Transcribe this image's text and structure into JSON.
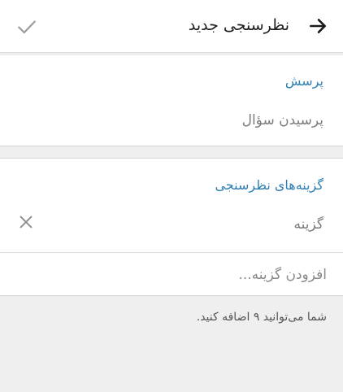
{
  "header": {
    "title": "نظرسنجی جدید",
    "back_icon": "arrow-right-icon",
    "confirm_icon": "check-icon"
  },
  "question": {
    "section_title": "پرسش",
    "placeholder": "پرسیدن سؤال"
  },
  "options": {
    "section_title": "گزینه‌های نظرسنجی",
    "items": [
      {
        "placeholder": "گزینه"
      }
    ],
    "remove_icon": "close-icon",
    "add_option_label": "افزودن گزینه..."
  },
  "hint": "شما می‌توانید ۹ اضافه کنید.",
  "colors": {
    "accent": "#2e7fb6",
    "background": "#efefef",
    "card": "#ffffff",
    "muted_text": "#7c7c7c",
    "icon_gray": "#9a9a9a"
  }
}
